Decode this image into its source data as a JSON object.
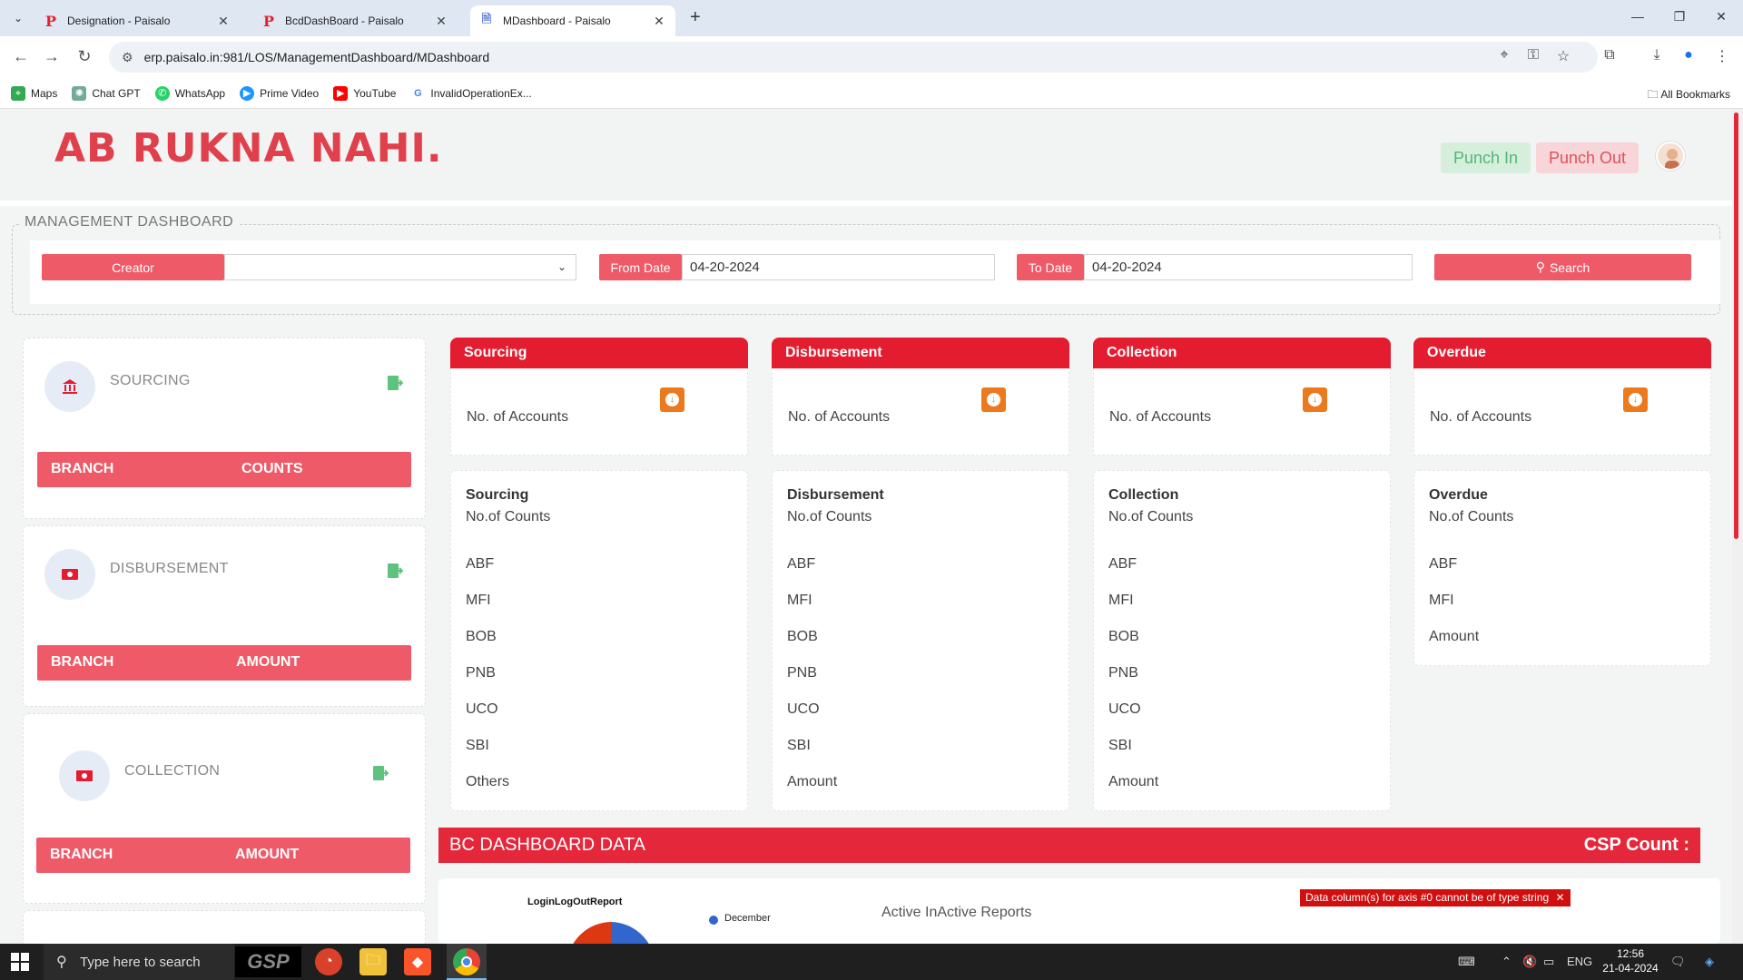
{
  "browser": {
    "tabs": [
      {
        "title": "Designation - Paisalo",
        "active": false,
        "favicon": "P"
      },
      {
        "title": "BcdDashBoard - Paisalo",
        "active": false,
        "favicon": "P"
      },
      {
        "title": "MDashboard - Paisalo",
        "active": true,
        "favicon": "document-icon"
      }
    ],
    "url": "erp.paisalo.in:981/LOS/ManagementDashboard/MDashboard",
    "bookmarks": [
      {
        "label": "Maps",
        "icon": "map-pin-icon",
        "color": "#34a853"
      },
      {
        "label": "Chat GPT",
        "icon": "chatgpt-icon",
        "color": "#74aa9c"
      },
      {
        "label": "WhatsApp",
        "icon": "whatsapp-icon",
        "color": "#25d366"
      },
      {
        "label": "Prime Video",
        "icon": "prime-video-icon",
        "color": "#1a98ff"
      },
      {
        "label": "YouTube",
        "icon": "youtube-icon",
        "color": "#ff0000"
      },
      {
        "label": "InvalidOperationEx...",
        "icon": "google-icon",
        "color": "#4285f4"
      }
    ],
    "all_bookmarks": "All Bookmarks"
  },
  "header": {
    "brand": "AB RUKNA NAHI.",
    "punch_in": "Punch In",
    "punch_out": "Punch Out"
  },
  "filter": {
    "legend": "MANAGEMENT DASHBOARD",
    "creator_label": "Creator",
    "creator_value": "",
    "from_label": "From Date",
    "from_value": "04-20-2024",
    "to_label": "To Date",
    "to_value": "04-20-2024",
    "search_label": "Search"
  },
  "left_cards": [
    {
      "title": "SOURCING",
      "col1": "BRANCH",
      "col2": "COUNTS",
      "icon": "bank-icon"
    },
    {
      "title": "DISBURSEMENT",
      "col1": "BRANCH",
      "col2": "AMOUNT",
      "icon": "money-icon"
    },
    {
      "title": "COLLECTION",
      "col1": "BRANCH",
      "col2": "AMOUNT",
      "icon": "money-icon"
    }
  ],
  "summary_cards": [
    {
      "title": "Sourcing",
      "label": "No. of Accounts"
    },
    {
      "title": "Disbursement",
      "label": "No. of Accounts"
    },
    {
      "title": "Collection",
      "label": "No. of Accounts"
    },
    {
      "title": "Overdue",
      "label": "No. of Accounts"
    }
  ],
  "detail_cards": [
    {
      "title": "Sourcing",
      "subtitle": "No.of Counts",
      "rows": [
        "ABF",
        "MFI",
        "BOB",
        "PNB",
        "UCO",
        "SBI",
        "Others"
      ]
    },
    {
      "title": "Disbursement",
      "subtitle": "No.of Counts",
      "rows": [
        "ABF",
        "MFI",
        "BOB",
        "PNB",
        "UCO",
        "SBI",
        "Amount"
      ]
    },
    {
      "title": "Collection",
      "subtitle": "No.of Counts",
      "rows": [
        "ABF",
        "MFI",
        "BOB",
        "PNB",
        "UCO",
        "SBI",
        "Amount"
      ]
    },
    {
      "title": "Overdue",
      "subtitle": "No.of Counts",
      "rows": [
        "ABF",
        "MFI",
        "Amount"
      ]
    }
  ],
  "bc_dashboard": {
    "title": "BC DASHBOARD DATA",
    "csp_label": "CSP Count :",
    "login_chart_title": "LoginLogOutReport",
    "legend_december": "December",
    "active_title": "Active InActive Reports",
    "error": "Data column(s) for axis #0 cannot be of type string"
  },
  "taskbar": {
    "search_placeholder": "Type here to search",
    "gsp": "GSP",
    "lang": "ENG",
    "time": "12:56",
    "date": "21-04-2024"
  },
  "colors": {
    "accent_red": "#e41c2f",
    "soft_red": "#ee5a67",
    "download_orange": "#ec7a1c"
  }
}
